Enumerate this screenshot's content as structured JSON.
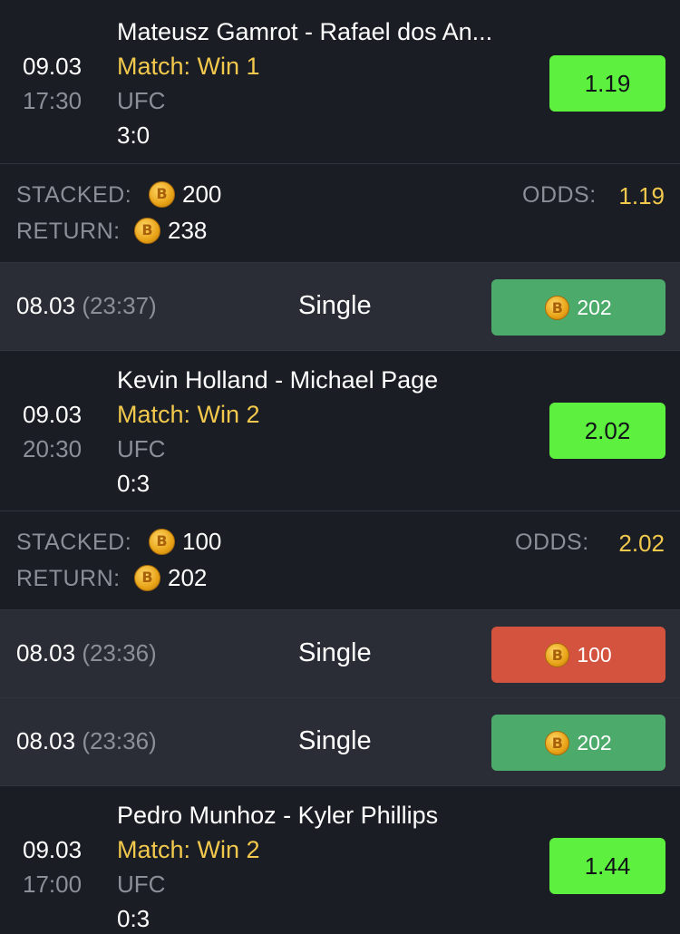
{
  "colors": {
    "background": "#1a1d24",
    "row_alt": "#2a2d35",
    "odds_green": "#5ef03e",
    "win_green": "#4cab6a",
    "loss_red": "#d4533f",
    "accent_yellow": "#f2c94c"
  },
  "matches": [
    {
      "date": "09.03",
      "time": "17:30",
      "title": "Mateusz Gamrot - Rafael dos An...",
      "market": "Match: Win 1",
      "league": "UFC",
      "score": "3:0",
      "odd": "1.19"
    },
    {
      "date": "09.03",
      "time": "20:30",
      "title": "Kevin Holland - Michael Page",
      "market": "Match: Win 2",
      "league": "UFC",
      "score": "0:3",
      "odd": "2.02"
    },
    {
      "date": "09.03",
      "time": "17:00",
      "title": "Pedro Munhoz - Kyler Phillips",
      "market": "Match: Win 2",
      "league": "UFC",
      "score": "0:3",
      "odd": "1.44"
    }
  ],
  "summaries": [
    {
      "stacked_label": "STACKED:",
      "stacked": "200",
      "return_label": "RETURN:",
      "return": "238",
      "odds_label": "ODDS:",
      "odds": "1.19",
      "coin_icon": "coin-icon"
    },
    {
      "stacked_label": "STACKED:",
      "stacked": "100",
      "return_label": "RETURN:",
      "return": "202",
      "odds_label": "ODDS:",
      "odds": "2.02",
      "coin_icon": "coin-icon"
    }
  ],
  "bets": [
    {
      "date": "08.03",
      "time": "(23:37)",
      "type": "Single",
      "amount": "202",
      "status": "win"
    },
    {
      "date": "08.03",
      "time": "(23:36)",
      "type": "Single",
      "amount": "100",
      "status": "loss"
    },
    {
      "date": "08.03",
      "time": "(23:36)",
      "type": "Single",
      "amount": "202",
      "status": "win"
    }
  ]
}
